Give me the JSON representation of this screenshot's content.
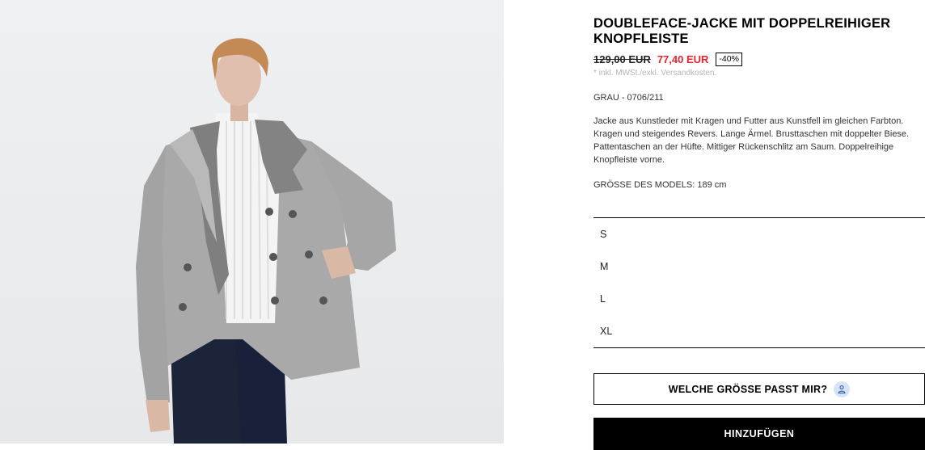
{
  "product": {
    "title": "DOUBLEFACE-JACKE MIT DOPPELREIHIGER KNOPFLEISTE",
    "old_price": "129,00 EUR",
    "new_price": "77,40 EUR",
    "discount": "-40%",
    "tax_note": "* inkl. MWSt./exkl. Versandkosten.",
    "color_ref": "GRAU - 0706/211",
    "description": "Jacke aus Kunstleder mit Kragen und Futter aus Kunstfell im gleichen Farbton. Kragen und steigendes Revers. Lange Ärmel. Brusttaschen mit doppelter Biese. Pattentaschen an der Hüfte. Mittiger Rückenschlitz am Saum. Doppelreihige Knopfleiste vorne.",
    "model_size": "GRÖSSE DES MODELS: 189 cm"
  },
  "sizes": [
    "S",
    "M",
    "L",
    "XL"
  ],
  "buttons": {
    "fit_label": "WELCHE GRÖSSE PASST MIR?",
    "add_label": "HINZUFÜGEN"
  },
  "icons": {
    "fit": "person-icon"
  },
  "colors": {
    "sale": "#e3262b",
    "accent": "#000000",
    "fit_icon_bg": "#d8e4f4"
  }
}
